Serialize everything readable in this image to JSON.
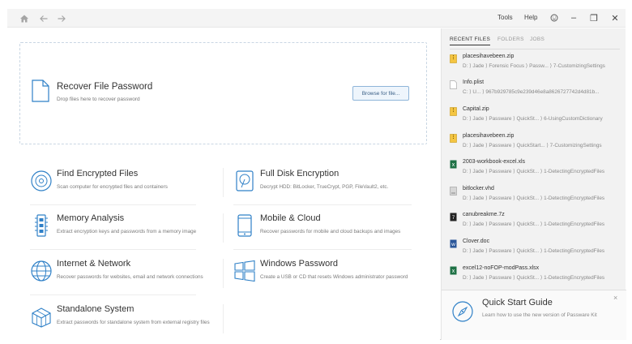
{
  "topbar": {
    "home_icon": "home-icon",
    "back_icon": "arrow-left-icon",
    "forward_icon": "arrow-right-icon",
    "menu_tools": "Tools",
    "menu_help": "Help",
    "smiley_icon": "smiley-icon",
    "minimize_glyph": "–",
    "restore_glyph": "❐",
    "close_glyph": "✕"
  },
  "recover": {
    "title": "Recover File Password",
    "subtitle": "Drop files here to recover password",
    "browse_label": "Browse for file..."
  },
  "features": [
    {
      "title": "Find Encrypted Files",
      "desc": "Scan computer for encrypted files and containers",
      "icon": "disc-icon"
    },
    {
      "title": "Full Disk Encryption",
      "desc": "Decrypt HDD: BitLocker, TrueCrypt, PGP, FileVault2, etc.",
      "icon": "hdd-icon"
    },
    {
      "title": "Memory Analysis",
      "desc": "Extract encryption keys and passwords from a memory image",
      "icon": "memory-chip-icon"
    },
    {
      "title": "Mobile & Cloud",
      "desc": "Recover passwords for mobile and cloud backups and images",
      "icon": "mobile-icon"
    },
    {
      "title": "Internet & Network",
      "desc": "Recover passwords for websites, email and network connections",
      "icon": "globe-icon"
    },
    {
      "title": "Windows Password",
      "desc": "Create a USB or CD that resets Windows administrator password",
      "icon": "windows-icon"
    },
    {
      "title": "Standalone System",
      "desc": "Extract passwords for standalone system from external registry files",
      "icon": "cubes-icon"
    }
  ],
  "right_panel": {
    "tabs": [
      "RECENT FILES",
      "FOLDERS",
      "JOBS"
    ],
    "files": [
      {
        "name": "placesihavebeen.zip",
        "path": "D: ⟩ Jade ⟩ Forensic Focus ⟩ Passw... ⟩ 7-CustomizingSettings",
        "icon": "zip-icon",
        "color": "#e6b422"
      },
      {
        "name": "Info.plist",
        "path": "C: ⟩ U... ⟩ 967b929785c9e239d46e8a8626727742d4d81b...",
        "icon": "file-icon",
        "color": "#b5b5b5"
      },
      {
        "name": "Capital.zip",
        "path": "D: ⟩ Jade ⟩ Passware ⟩ QuickSt... ⟩ 6-UsingCustomDictionary",
        "icon": "zip-icon",
        "color": "#e6b422"
      },
      {
        "name": "placesihavebeen.zip",
        "path": "D: ⟩ Jade ⟩ Passware ⟩ QuickStart... ⟩ 7-CustomizingSettings",
        "icon": "zip-icon",
        "color": "#e6b422"
      },
      {
        "name": "2003-workbook-excel.xls",
        "path": "D: ⟩ Jade ⟩ Passware ⟩ QuickSt... ⟩ 1-DetectingEncryptedFiles",
        "icon": "excel-icon",
        "color": "#1e7145"
      },
      {
        "name": "bitlocker.vhd",
        "path": "D: ⟩ Jade ⟩ Passware ⟩ QuickSt... ⟩ 1-DetectingEncryptedFiles",
        "icon": "disk-image-icon",
        "color": "#9a9a9a"
      },
      {
        "name": "canubreakme.7z",
        "path": "D: ⟩ Jade ⟩ Passware ⟩ QuickSt... ⟩ 1-DetectingEncryptedFiles",
        "icon": "archive-7z-icon",
        "color": "#333333"
      },
      {
        "name": "Clover.doc",
        "path": "D: ⟩ Jade ⟩ Passware ⟩ QuickSt... ⟩ 1-DetectingEncryptedFiles",
        "icon": "word-icon",
        "color": "#2b579a"
      },
      {
        "name": "excel12-noFOP-modPass.xlsx",
        "path": "D: ⟩ Jade ⟩ Passware ⟩ QuickSt... ⟩ 1-DetectingEncryptedFiles",
        "icon": "excel-icon",
        "color": "#1e7145"
      }
    ],
    "quick_start": {
      "title": "Quick Start Guide",
      "subtitle": "Learn how to use the new version of Passware Kit",
      "close_glyph": "×",
      "icon": "compass-icon"
    }
  },
  "colors": {
    "accent_blue": "#2f80c7",
    "panel_bg": "#f2f2f2"
  }
}
